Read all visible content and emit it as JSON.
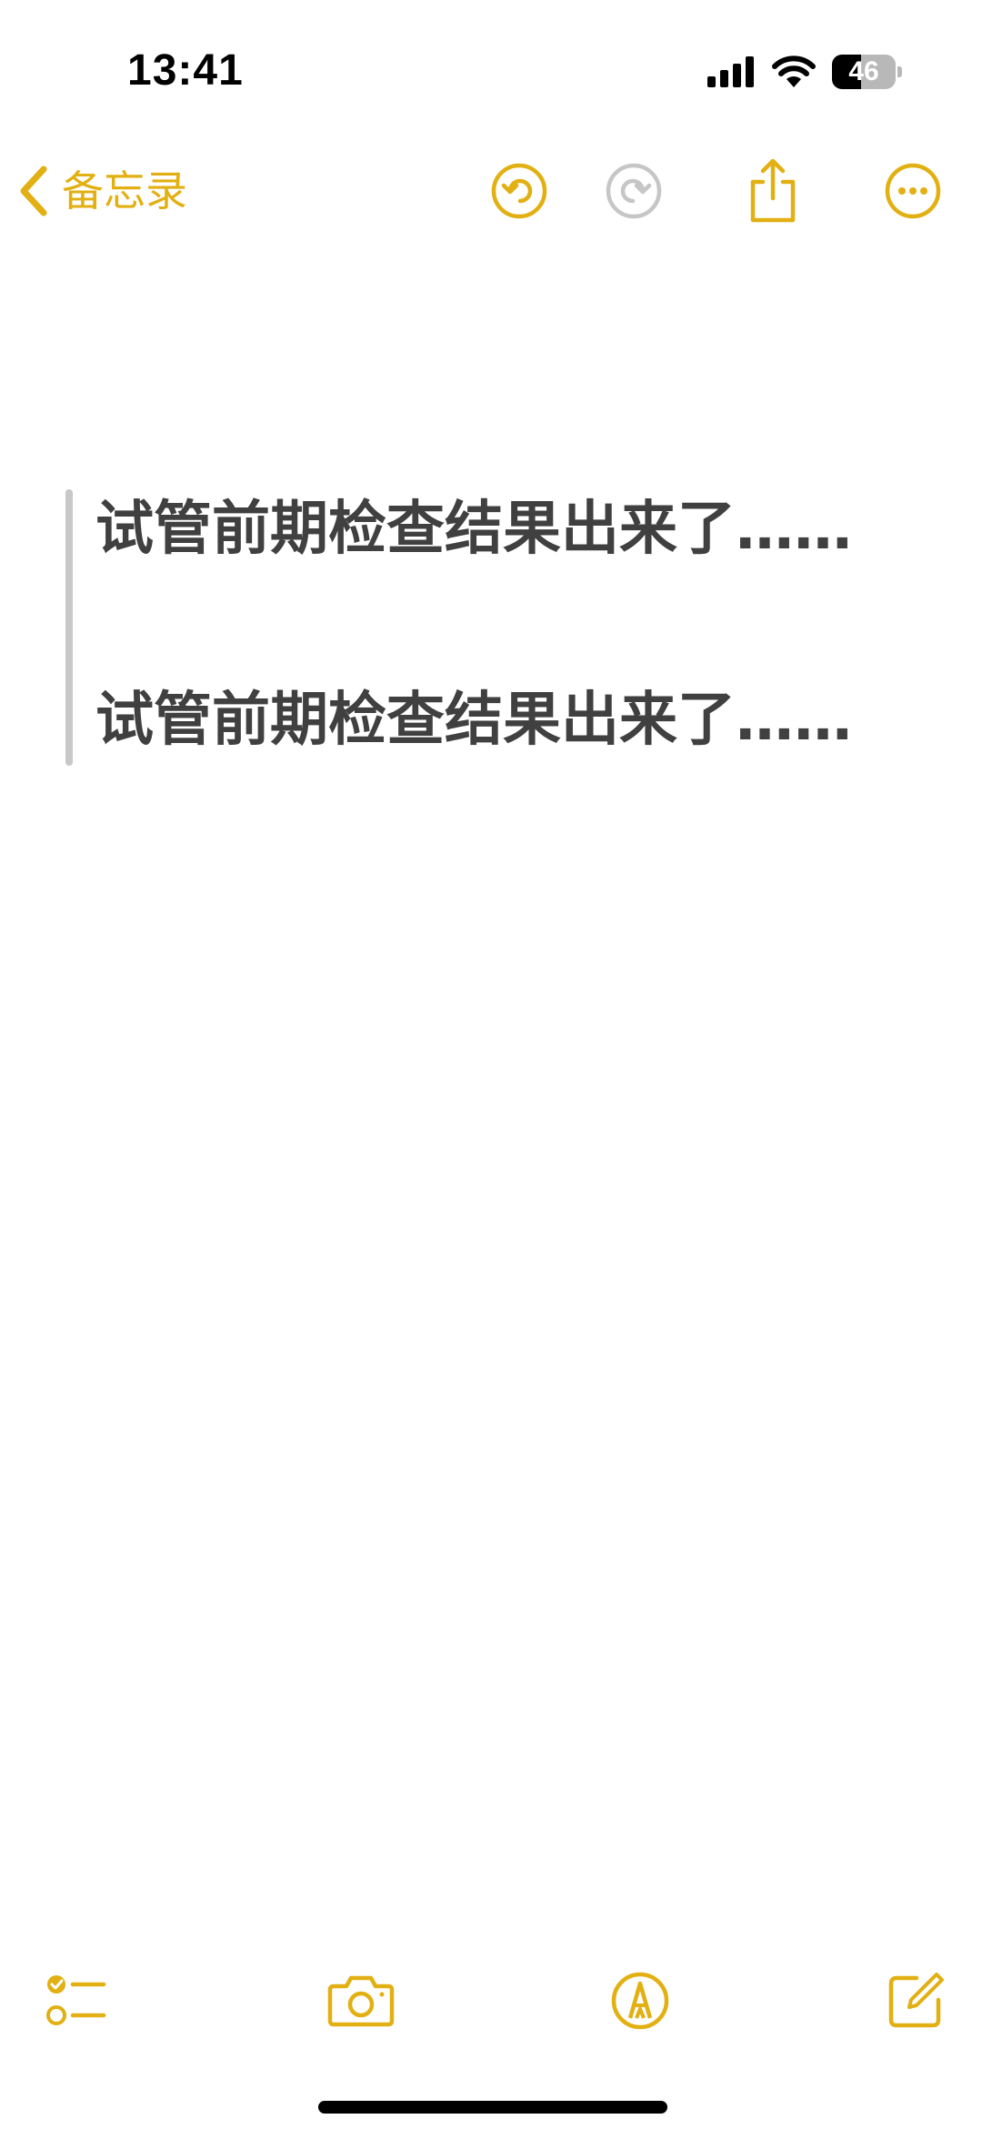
{
  "status_bar": {
    "time": "13:41",
    "battery_level": "46",
    "battery_fraction": 0.46,
    "signal_icon": "cellular-signal-icon",
    "wifi_icon": "wifi-icon"
  },
  "nav": {
    "back_label": "备忘录",
    "back_icon": "chevron-left-icon",
    "undo_icon": "undo-icon",
    "redo_icon": "redo-icon",
    "share_icon": "share-icon",
    "more_icon": "more-icon"
  },
  "note": {
    "lines": [
      "试管前期检查结果出来了……",
      "试管前期检查结果出来了……"
    ]
  },
  "toolbar": {
    "checklist_icon": "checklist-icon",
    "camera_icon": "camera-icon",
    "markup_icon": "markup-pen-icon",
    "compose_icon": "compose-icon"
  },
  "colors": {
    "accent": "#e2b012",
    "disabled": "#c6c6c6",
    "text": "#404040",
    "quote_bar": "#c8c8c8"
  }
}
